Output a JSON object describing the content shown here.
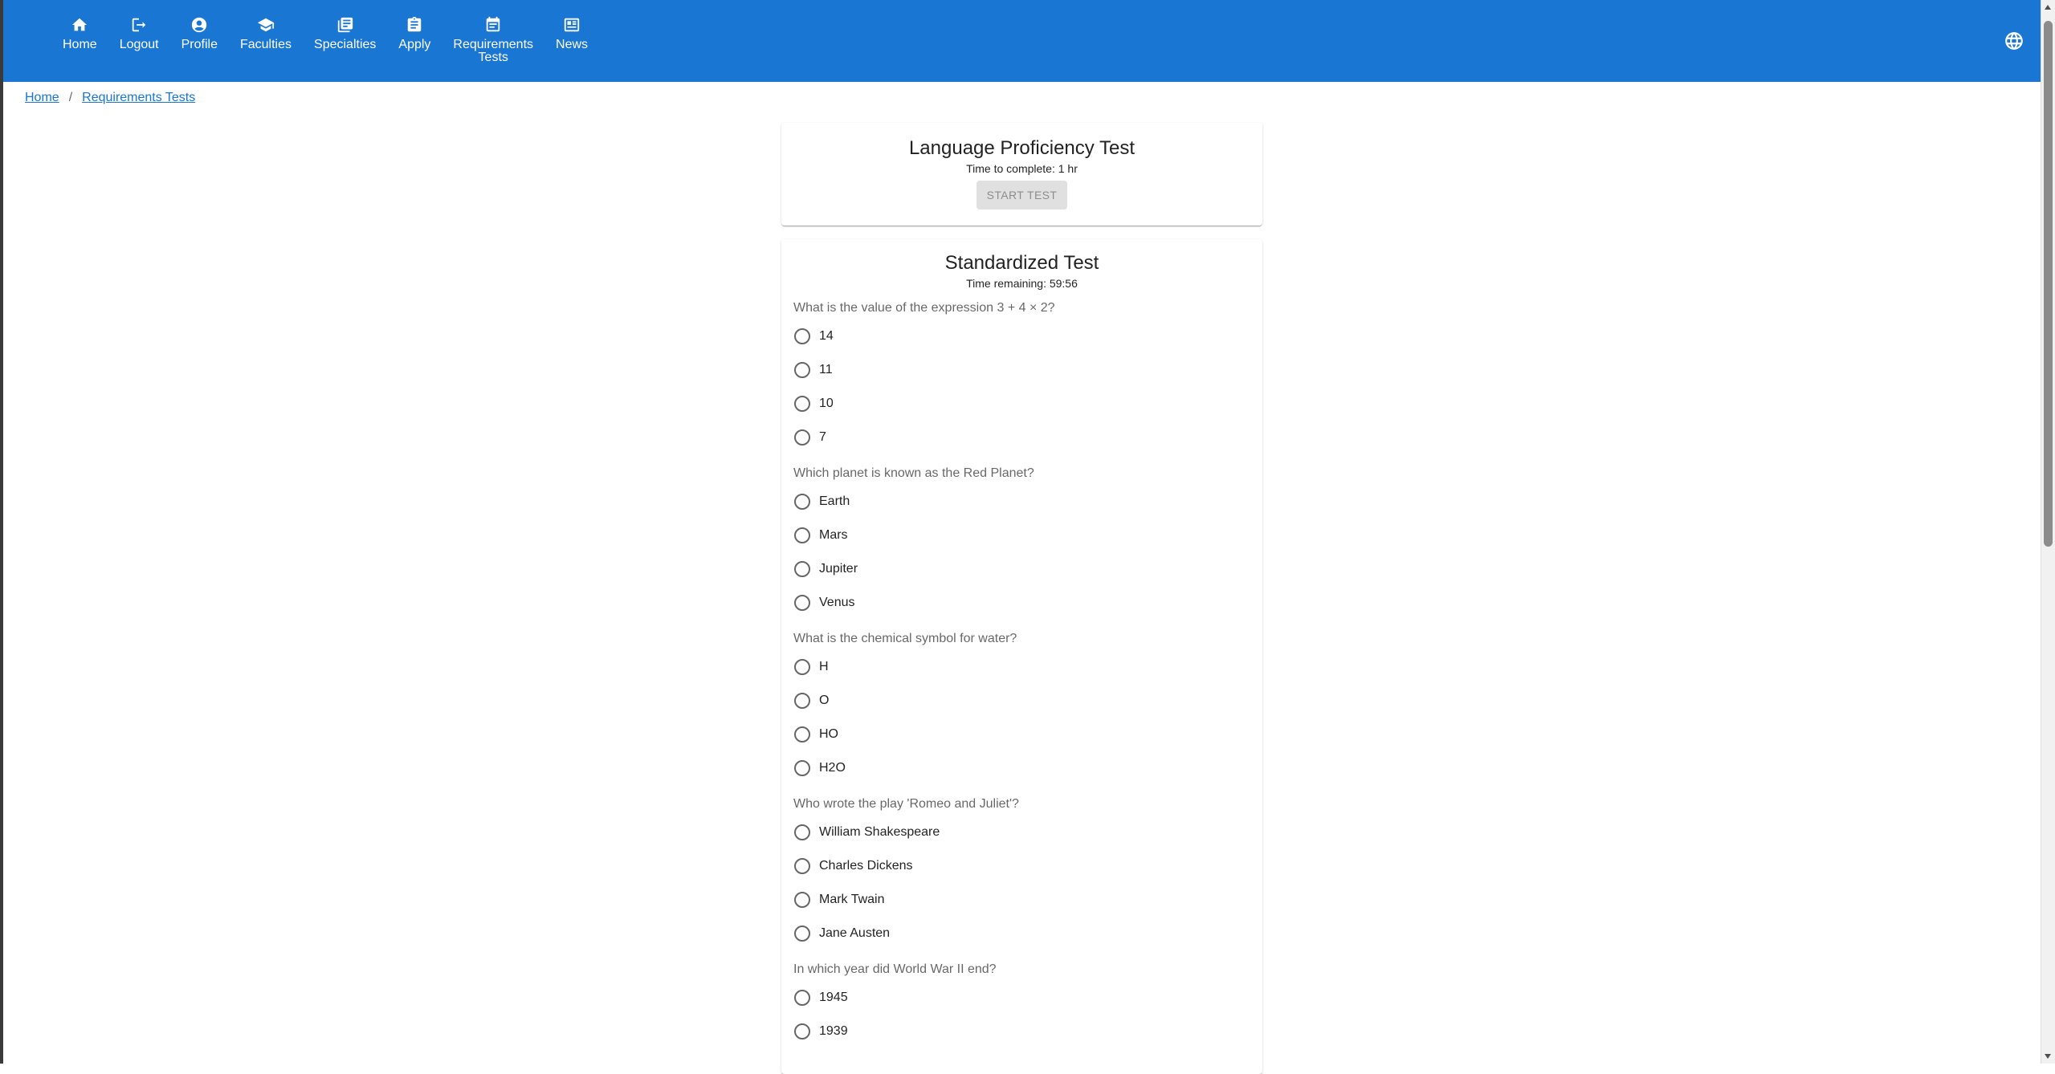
{
  "nav": {
    "items": [
      {
        "label": "Home",
        "icon": "home-icon"
      },
      {
        "label": "Logout",
        "icon": "logout-icon"
      },
      {
        "label": "Profile",
        "icon": "account-circle-icon"
      },
      {
        "label": "Faculties",
        "icon": "school-icon"
      },
      {
        "label": "Specialties",
        "icon": "library-books-icon"
      },
      {
        "label": "Apply",
        "icon": "assignment-icon"
      },
      {
        "label": "Requirements\nTests",
        "icon": "event-note-icon"
      },
      {
        "label": "News",
        "icon": "newspaper-icon"
      }
    ],
    "language_icon": "globe-icon"
  },
  "colors": {
    "primary": "#1976d2"
  },
  "breadcrumb": {
    "home": "Home",
    "current": "Requirements Tests",
    "separator": "/"
  },
  "language_test": {
    "title": "Language Proficiency Test",
    "time": "Time to complete: 1 hr",
    "button": "START TEST"
  },
  "standardized_test": {
    "title": "Standardized Test",
    "time_remaining": "Time remaining: 59:56",
    "questions": [
      {
        "text": "What is the value of the expression 3 + 4 × 2?",
        "options": [
          "14",
          "11",
          "10",
          "7"
        ]
      },
      {
        "text": "Which planet is known as the Red Planet?",
        "options": [
          "Earth",
          "Mars",
          "Jupiter",
          "Venus"
        ]
      },
      {
        "text": "What is the chemical symbol for water?",
        "options": [
          "H",
          "O",
          "HO",
          "H2O"
        ]
      },
      {
        "text": "Who wrote the play 'Romeo and Juliet'?",
        "options": [
          "William Shakespeare",
          "Charles Dickens",
          "Mark Twain",
          "Jane Austen"
        ]
      },
      {
        "text": "In which year did World War II end?",
        "options": [
          "1945",
          "1939"
        ]
      }
    ]
  }
}
